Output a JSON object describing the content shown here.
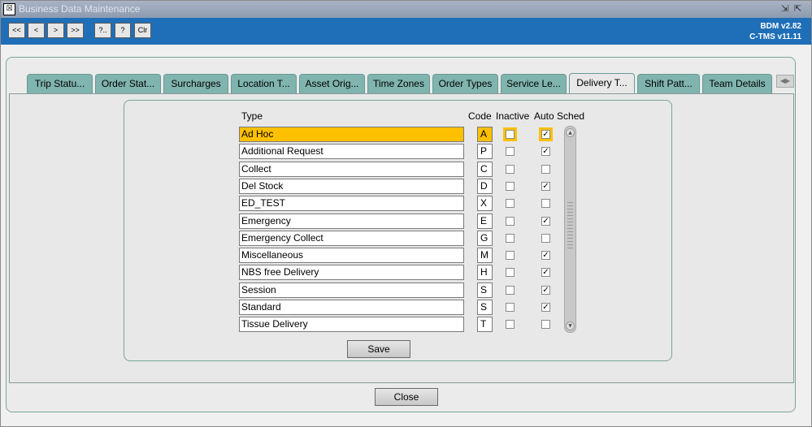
{
  "window": {
    "title": "Business Data Maintenance",
    "controls": [
      "⇲",
      "⇱"
    ]
  },
  "toolbar": {
    "buttons": [
      "<<",
      "<",
      ">",
      ">>",
      "?..",
      "?",
      "Clr"
    ],
    "version_line1": "BDM v2.82",
    "version_line2": "C-TMS v11.11"
  },
  "tabs": [
    "Trip Statu...",
    "Order Stat...",
    "Surcharges",
    "Location T...",
    "Asset Orig...",
    "Time Zones",
    "Order Types",
    "Service Le...",
    "Delivery T...",
    "Shift Patt...",
    "Team Details"
  ],
  "active_tab": "Delivery T...",
  "columns": {
    "type": "Type",
    "code": "Code",
    "inactive": "Inactive",
    "auto_sched": "Auto Sched"
  },
  "rows": [
    {
      "type": "Ad Hoc",
      "code": "A",
      "inactive": false,
      "auto": true,
      "selected": true
    },
    {
      "type": "Additional Request",
      "code": "P",
      "inactive": false,
      "auto": true
    },
    {
      "type": "Collect",
      "code": "C",
      "inactive": false,
      "auto": false
    },
    {
      "type": "Del Stock",
      "code": "D",
      "inactive": false,
      "auto": true
    },
    {
      "type": "ED_TEST",
      "code": "X",
      "inactive": false,
      "auto": false
    },
    {
      "type": "Emergency",
      "code": "E",
      "inactive": false,
      "auto": true
    },
    {
      "type": "Emergency Collect",
      "code": "G",
      "inactive": false,
      "auto": false
    },
    {
      "type": "Miscellaneous",
      "code": "M",
      "inactive": false,
      "auto": true
    },
    {
      "type": "NBS free Delivery",
      "code": "H",
      "inactive": false,
      "auto": true
    },
    {
      "type": "Session",
      "code": "S",
      "inactive": false,
      "auto": true
    },
    {
      "type": "Standard",
      "code": "S",
      "inactive": false,
      "auto": true
    },
    {
      "type": "Tissue Delivery",
      "code": "T",
      "inactive": false,
      "auto": false
    }
  ],
  "save_label": "Save",
  "close_label": "Close",
  "colors": {
    "toolbar": "#1f6fb8",
    "tab": "#80b4ae",
    "selection": "#fec000"
  }
}
